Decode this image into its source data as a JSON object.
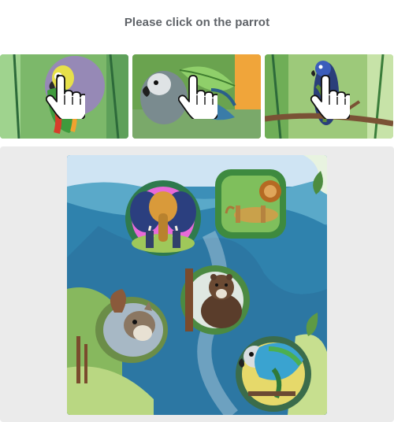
{
  "prompt": {
    "title": "Please click on the parrot"
  },
  "examples": [
    {
      "name": "parrot-example-1",
      "icon": "pointer-hand-icon"
    },
    {
      "name": "parrot-example-2",
      "icon": "pointer-hand-icon"
    },
    {
      "name": "parrot-example-3",
      "icon": "pointer-hand-icon"
    }
  ],
  "scene": {
    "background": "watercolor river valley",
    "animals": [
      "elephant",
      "lion",
      "bear",
      "squirrel",
      "parrot"
    ]
  },
  "colors": {
    "panel": "#ebebeb",
    "title": "#5f6368",
    "water": "#2f82ad",
    "sky": "#cfe4f3"
  }
}
